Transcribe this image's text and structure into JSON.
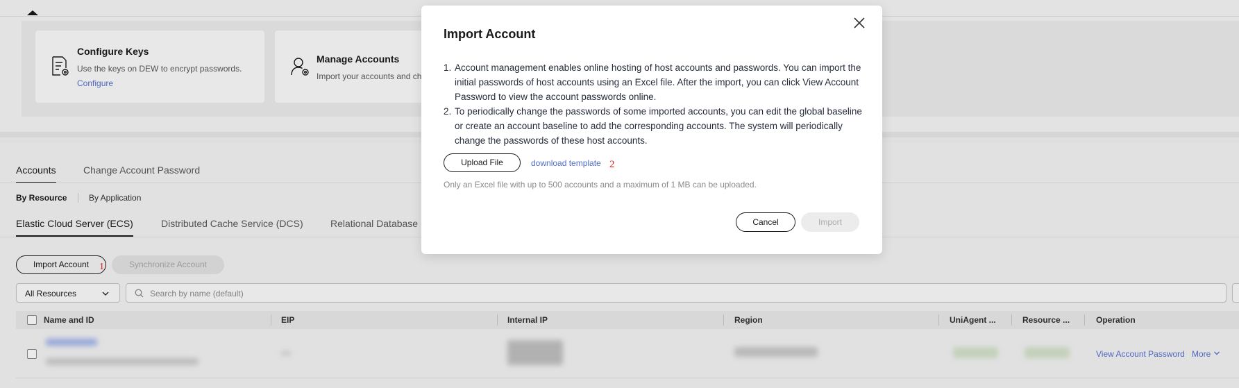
{
  "top_cards": {
    "configure": {
      "title": "Configure Keys",
      "desc": "Use the keys on DEW to encrypt passwords.",
      "link": "Configure",
      "icon": "document-gear-icon"
    },
    "manage": {
      "title": "Manage Accounts",
      "desc": "Import your accounts and ch",
      "icon": "user-gear-icon"
    }
  },
  "tabs": {
    "accounts": "Accounts",
    "change_password": "Change Account Password"
  },
  "subtabs": {
    "by_resource": "By Resource",
    "by_application": "By Application"
  },
  "service_tabs": {
    "ecs": "Elastic Cloud Server (ECS)",
    "dcs": "Distributed Cache Service (DCS)",
    "rds": "Relational Database"
  },
  "actions": {
    "import_account": "Import Account",
    "sync_account": "Synchronize Account",
    "marker_1": "1"
  },
  "filter": {
    "resource_select": "All Resources",
    "search_placeholder": "Search by name (default)"
  },
  "table": {
    "headers": {
      "name": "Name and ID",
      "eip": "EIP",
      "internal_ip": "Internal IP",
      "region": "Region",
      "uniagent": "UniAgent ...",
      "resource": "Resource ...",
      "operation": "Operation"
    },
    "row": {
      "view_password": "View Account Password",
      "more": "More"
    }
  },
  "modal": {
    "title": "Import Account",
    "items": [
      {
        "num": "1.",
        "text": "Account management enables online hosting of host accounts and passwords. You can import the initial passwords of host accounts using an Excel file. After the import, you can click View Account Password to view the account passwords online."
      },
      {
        "num": "2.",
        "text": "To periodically change the passwords of some imported accounts, you can edit the global baseline or create an account baseline to add the corresponding accounts. The system will periodically change the passwords of these host accounts."
      }
    ],
    "upload_button": "Upload File",
    "download_link": "download template",
    "marker_2": "2",
    "hint": "Only an Excel file with up to 500 accounts and a maximum of 1 MB can be uploaded.",
    "cancel": "Cancel",
    "import": "Import"
  }
}
